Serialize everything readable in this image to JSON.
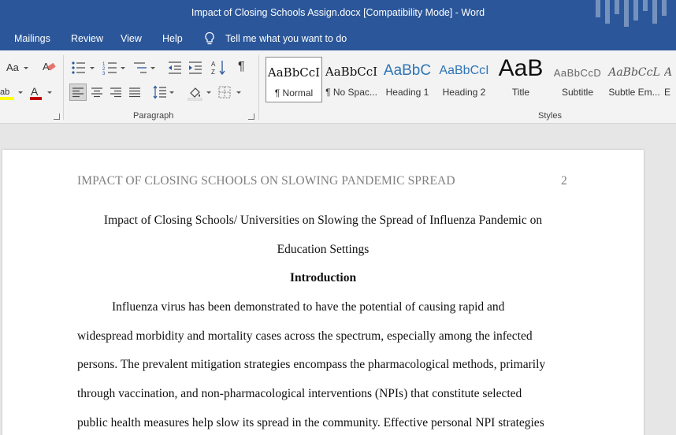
{
  "titlebar": {
    "title": "Impact of Closing Schools Assign.docx [Compatibility Mode]  -  Word"
  },
  "menu": {
    "mailings": "Mailings",
    "review": "Review",
    "view": "View",
    "help": "Help",
    "tell_me": "Tell me what you want to do"
  },
  "ribbon": {
    "font_size_label": "Aa",
    "paragraph_label": "Paragraph",
    "styles_label": "Styles",
    "highlight_color": "#ffff00",
    "font_color": "#c00000",
    "styles": [
      {
        "sample": "AaBbCcI",
        "name": "¶ Normal"
      },
      {
        "sample": "AaBbCcI",
        "name": "¶ No Spac..."
      },
      {
        "sample": "AaBbC",
        "name": "Heading 1"
      },
      {
        "sample": "AaBbCcI",
        "name": "Heading 2"
      },
      {
        "sample": "AaB",
        "name": "Title"
      },
      {
        "sample": "AaBbCcD",
        "name": "Subtitle"
      },
      {
        "sample": "AaBbCcL",
        "name": "Subtle Em..."
      },
      {
        "sample": "A",
        "name": "E"
      }
    ]
  },
  "document": {
    "running_head": "IMPACT OF CLOSING SCHOOLS ON SLOWING PANDEMIC SPREAD",
    "page_number": "2",
    "title_line1": "Impact of Closing Schools/ Universities on Slowing the Spread of Influenza Pandemic on",
    "title_line2": "Education Settings",
    "heading": "Introduction",
    "body_lines": [
      "Influenza virus has been demonstrated to have the potential of causing rapid and",
      "widespread morbidity and mortality cases across the spectrum, especially among the infected",
      "persons. The prevalent mitigation strategies encompass the pharmacological methods, primarily",
      "through vaccination, and non-pharmacological interventions (NPIs) that constitute selected",
      "public health measures help slow its spread in the community. Effective personal NPI strategies"
    ]
  }
}
